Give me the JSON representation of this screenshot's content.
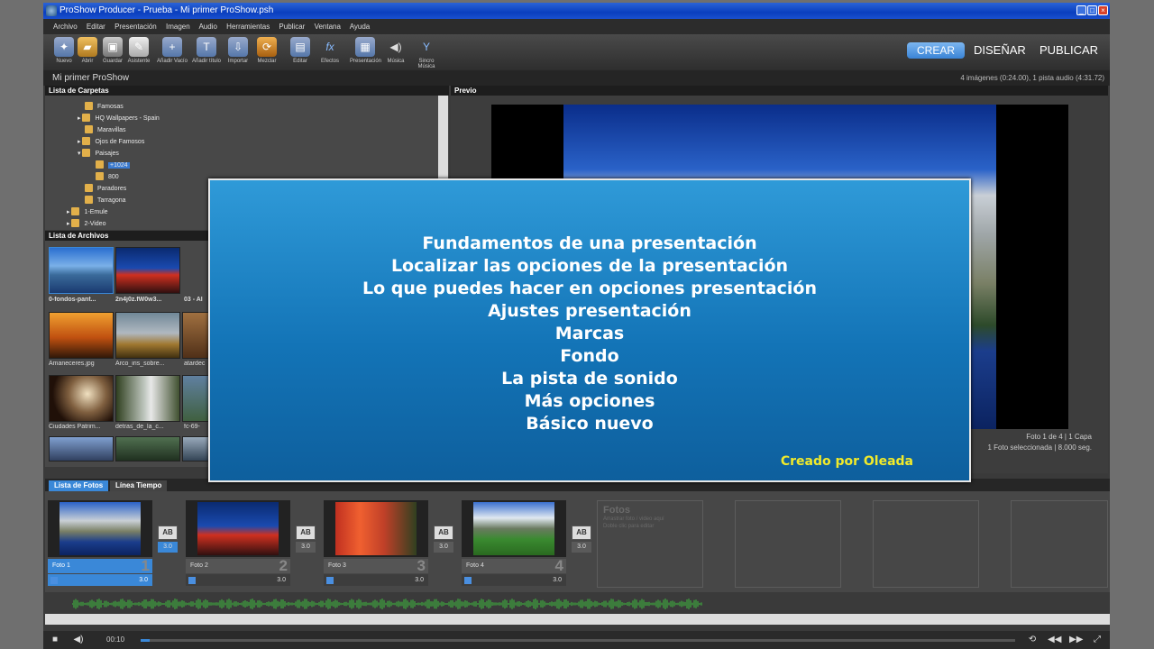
{
  "window": {
    "title": "ProShow Producer - Prueba - Mi primer ProShow.psh"
  },
  "menu": [
    "Archivo",
    "Editar",
    "Presentación",
    "Imagen",
    "Audio",
    "Herramientas",
    "Publicar",
    "Ventana",
    "Ayuda"
  ],
  "toolbar": [
    {
      "label": "Nuevo",
      "icon": "new-icon"
    },
    {
      "label": "Abrir",
      "icon": "open-folder-icon"
    },
    {
      "label": "Guardar",
      "icon": "save-icon"
    },
    {
      "label": "Asistente",
      "icon": "wizard-icon"
    },
    {
      "label": "Añadir Vacío",
      "icon": "add-blank-icon"
    },
    {
      "label": "Añadir título",
      "icon": "add-title-icon"
    },
    {
      "label": "Importar",
      "icon": "import-icon"
    },
    {
      "label": "Mezclar",
      "icon": "shuffle-icon"
    },
    {
      "label": "Editar",
      "icon": "edit-icon"
    },
    {
      "label": "Efectos",
      "icon": "effects-icon"
    },
    {
      "label": "Presentación",
      "icon": "presentation-icon"
    },
    {
      "label": "Música",
      "icon": "music-icon"
    },
    {
      "label": "Sincro Música",
      "icon": "sync-music-icon"
    }
  ],
  "modes": {
    "crear": "CREAR",
    "disenar": "DISEÑAR",
    "publicar": "PUBLICAR"
  },
  "project": {
    "name": "Mi primer ProShow",
    "info": "4 imágenes (0:24.00), 1 pista audio (4:31.72)"
  },
  "folders": {
    "title": "Lista de Carpetas",
    "items": [
      "Famosas",
      "HQ Wallpapers - Spain",
      "Maravillas",
      "Ojos de Famosos",
      "Paisajes",
      "+1024",
      "800",
      "Paradores",
      "Tarragona",
      "1-Emule",
      "2-Video"
    ]
  },
  "files": {
    "title": "Lista de Archivos",
    "items": [
      "0-fondos-pant...",
      "2n4j0z.fW0w3...",
      "03 - Al",
      "Amaneceres.jpg",
      "Arco_iris_sobre...",
      "atardec",
      "Ciudades Patrim...",
      "detras_de_la_c...",
      "fc-69-"
    ]
  },
  "preview": {
    "title": "Previo",
    "info1": "Foto 1 de 4 | 1 Capa",
    "info2": "1 Foto seleccionada | 8.000 seg."
  },
  "overlay": {
    "lines": [
      "Fundamentos de una presentación",
      "Localizar las opciones de la presentación",
      "Lo que puedes hacer en opciones presentación",
      "Ajustes presentación",
      "Marcas",
      "Fondo",
      "La pista de sonido",
      "Más opciones",
      "Básico  nuevo"
    ],
    "credit": "Creado por Oleada"
  },
  "tabs": [
    "Lista de Fotos",
    "Línea Tiempo"
  ],
  "slides": [
    {
      "label": "Foto 1",
      "num": "1",
      "duration": "3.0",
      "trans": "3.0"
    },
    {
      "label": "Foto 2",
      "num": "2",
      "duration": "3.0",
      "trans": "3.0"
    },
    {
      "label": "Foto 3",
      "num": "3",
      "duration": "3.0",
      "trans": "3.0"
    },
    {
      "label": "Foto 4",
      "num": "4",
      "duration": "3.0",
      "trans": "3.0"
    }
  ],
  "placeholder": {
    "title": "Fotos",
    "line1": "Arrastrar foto / video aquí",
    "line2": "Doble clic para editar"
  },
  "transition_label": "AB",
  "playback": {
    "time": "00:10",
    "progress": 0.01
  }
}
